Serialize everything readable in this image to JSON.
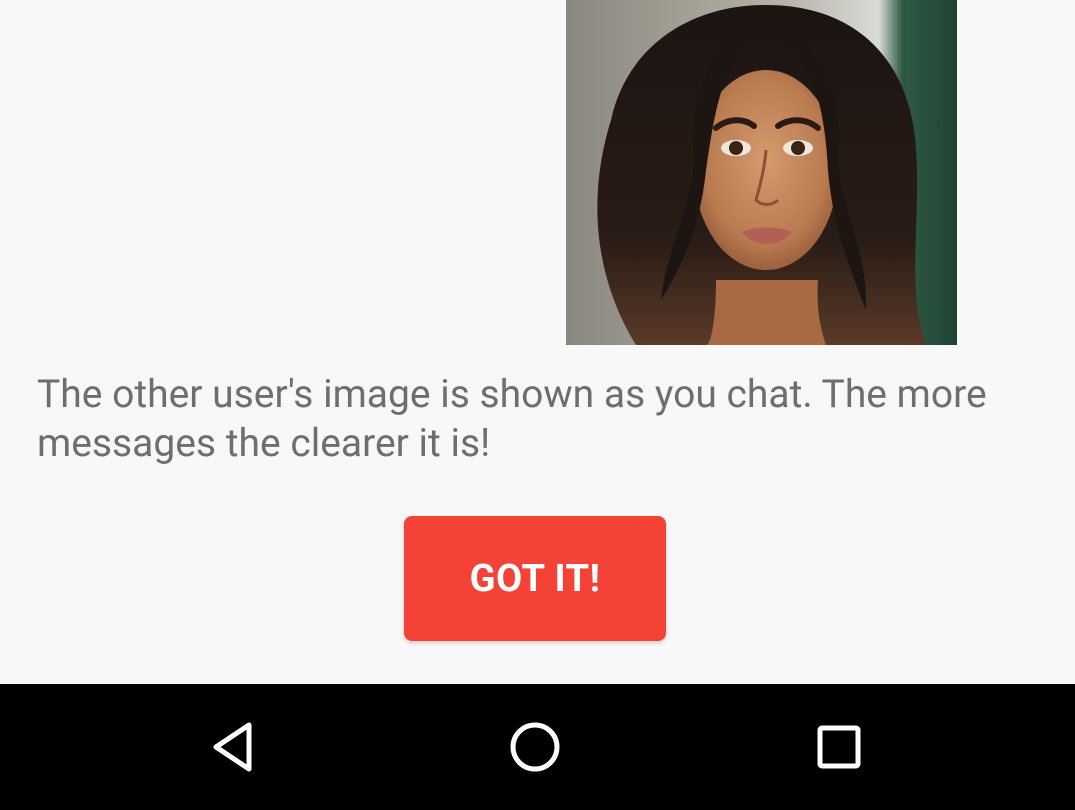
{
  "onboarding": {
    "photo_alt": "Other user's profile photo",
    "caption": "The other user's image is shown as you chat. The more messages the clearer it is!",
    "confirm_label": "GOT IT!"
  },
  "navigation_bar": {
    "buttons": [
      {
        "name": "back",
        "icon": "back-triangle-icon"
      },
      {
        "name": "home",
        "icon": "home-circle-icon"
      },
      {
        "name": "recents",
        "icon": "recents-square-icon"
      }
    ]
  },
  "colors": {
    "background": "#f8f8f8",
    "caption_text": "#6e6e6e",
    "accent_button": "#f44336",
    "button_text": "#ffffff",
    "nav_bar": "#000000",
    "nav_icons": "#ffffff"
  }
}
